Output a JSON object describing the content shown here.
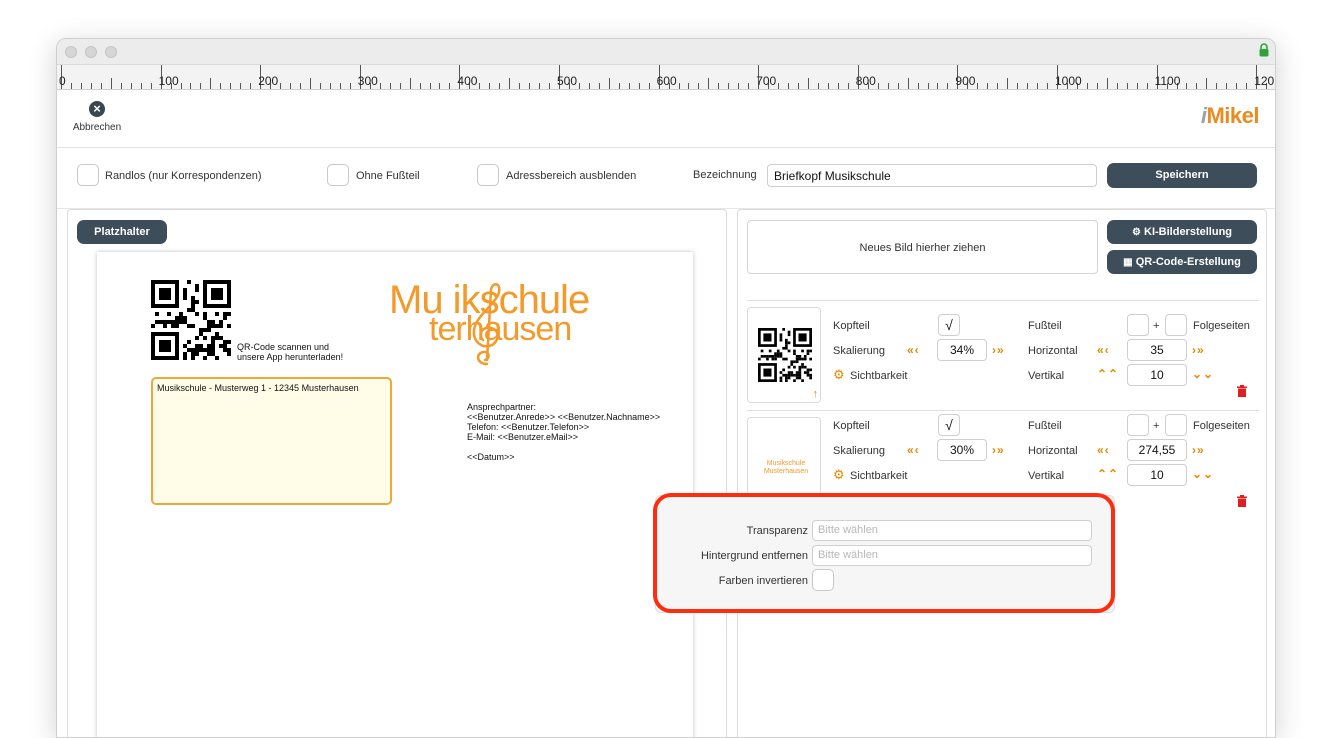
{
  "ruler": {
    "labels": [
      "0",
      "100",
      "200",
      "300",
      "400",
      "500",
      "600",
      "700",
      "800",
      "900",
      "1000",
      "1100",
      "120"
    ]
  },
  "toolbar": {
    "cancel_label": "Abbrechen",
    "logo_i": "i",
    "logo_rest": "Mikel"
  },
  "options": {
    "randlos": "Randlos (nur Korrespondenzen)",
    "ohne_fussteil": "Ohne Fußteil",
    "adressbereich": "Adressbereich ausblenden",
    "bezeichnung_label": "Bezeichnung",
    "bezeichnung_value": "Briefkopf Musikschule",
    "save_label": "Speichern"
  },
  "left": {
    "placeholder_button": "Platzhalter",
    "qr_caption_1": "QR-Code scannen und",
    "qr_caption_2": "unsere App herunterladen!",
    "logo_line1": "Mu  ikschule",
    "logo_line2": "  terhausen",
    "address_line": "Musikschule - Musterweg 1 - 12345 Musterhausen",
    "contact": [
      "Ansprechpartner:",
      "<<Benutzer.Anrede>> <<Benutzer.Nachname>>",
      "Telefon: <<Benutzer.Telefon>>",
      "E-Mail: <<Benutzer.eMail>>",
      "",
      "<<Datum>>"
    ]
  },
  "right": {
    "dropzone": "Neues Bild hierher ziehen",
    "ki_button": "KI-Bilderstellung",
    "qr_button": "QR-Code-Erstellung",
    "rows": [
      {
        "kopfteil": "Kopfteil",
        "kopf_checked": "√",
        "fussteil": "Fußteil",
        "plus": "+",
        "folgeseiten": "Folgeseiten",
        "skalierung": "Skalierung",
        "scale": "34%",
        "horizontal": "Horizontal",
        "h_value": "35",
        "sichtbarkeit": "Sichtbarkeit",
        "vertikal": "Vertikal",
        "v_value": "10",
        "thumb_text": ""
      },
      {
        "kopfteil": "Kopfteil",
        "kopf_checked": "√",
        "fussteil": "Fußteil",
        "plus": "+",
        "folgeseiten": "Folgeseiten",
        "skalierung": "Skalierung",
        "scale": "30%",
        "horizontal": "Horizontal",
        "h_value": "274,55",
        "sichtbarkeit": "Sichtbarkeit",
        "vertikal": "Vertikal",
        "v_value": "10",
        "thumb_text": "Musikschule Musterhausen"
      }
    ]
  },
  "popup": {
    "transparenz_label": "Transparenz",
    "transparenz_placeholder": "Bitte wählen",
    "hintergrund_label": "Hintergrund entfernen",
    "hintergrund_placeholder": "Bitte wählen",
    "invert_label": "Farben invertieren"
  },
  "colors": {
    "accent": "#e68a00",
    "button": "#3d4e5a",
    "highlight": "#ff2d10",
    "logo": "#f39a2b"
  }
}
